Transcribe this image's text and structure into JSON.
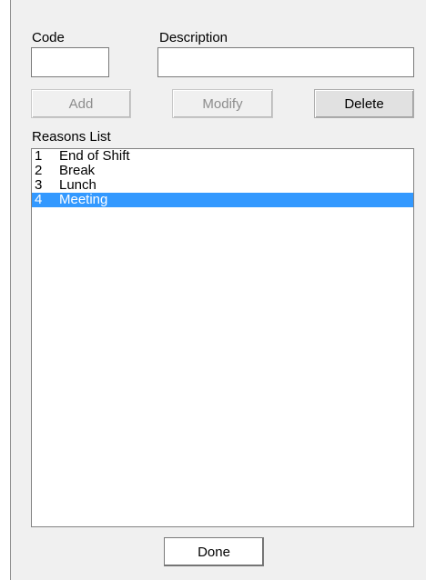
{
  "fields": {
    "code": {
      "label": "Code",
      "value": ""
    },
    "description": {
      "label": "Description",
      "value": ""
    }
  },
  "buttons": {
    "add": {
      "label": "Add",
      "enabled": false
    },
    "modify": {
      "label": "Modify",
      "enabled": false
    },
    "delete": {
      "label": "Delete",
      "enabled": true
    },
    "done": {
      "label": "Done",
      "enabled": true
    }
  },
  "reasons_list": {
    "label": "Reasons List",
    "items": [
      {
        "code": "1",
        "description": "End of Shift",
        "selected": false
      },
      {
        "code": "2",
        "description": "Break",
        "selected": false
      },
      {
        "code": "3",
        "description": "Lunch",
        "selected": false
      },
      {
        "code": "4",
        "description": "Meeting",
        "selected": true
      }
    ]
  },
  "colors": {
    "selection": "#3399ff",
    "dialog_background": "#f0f0f0"
  }
}
